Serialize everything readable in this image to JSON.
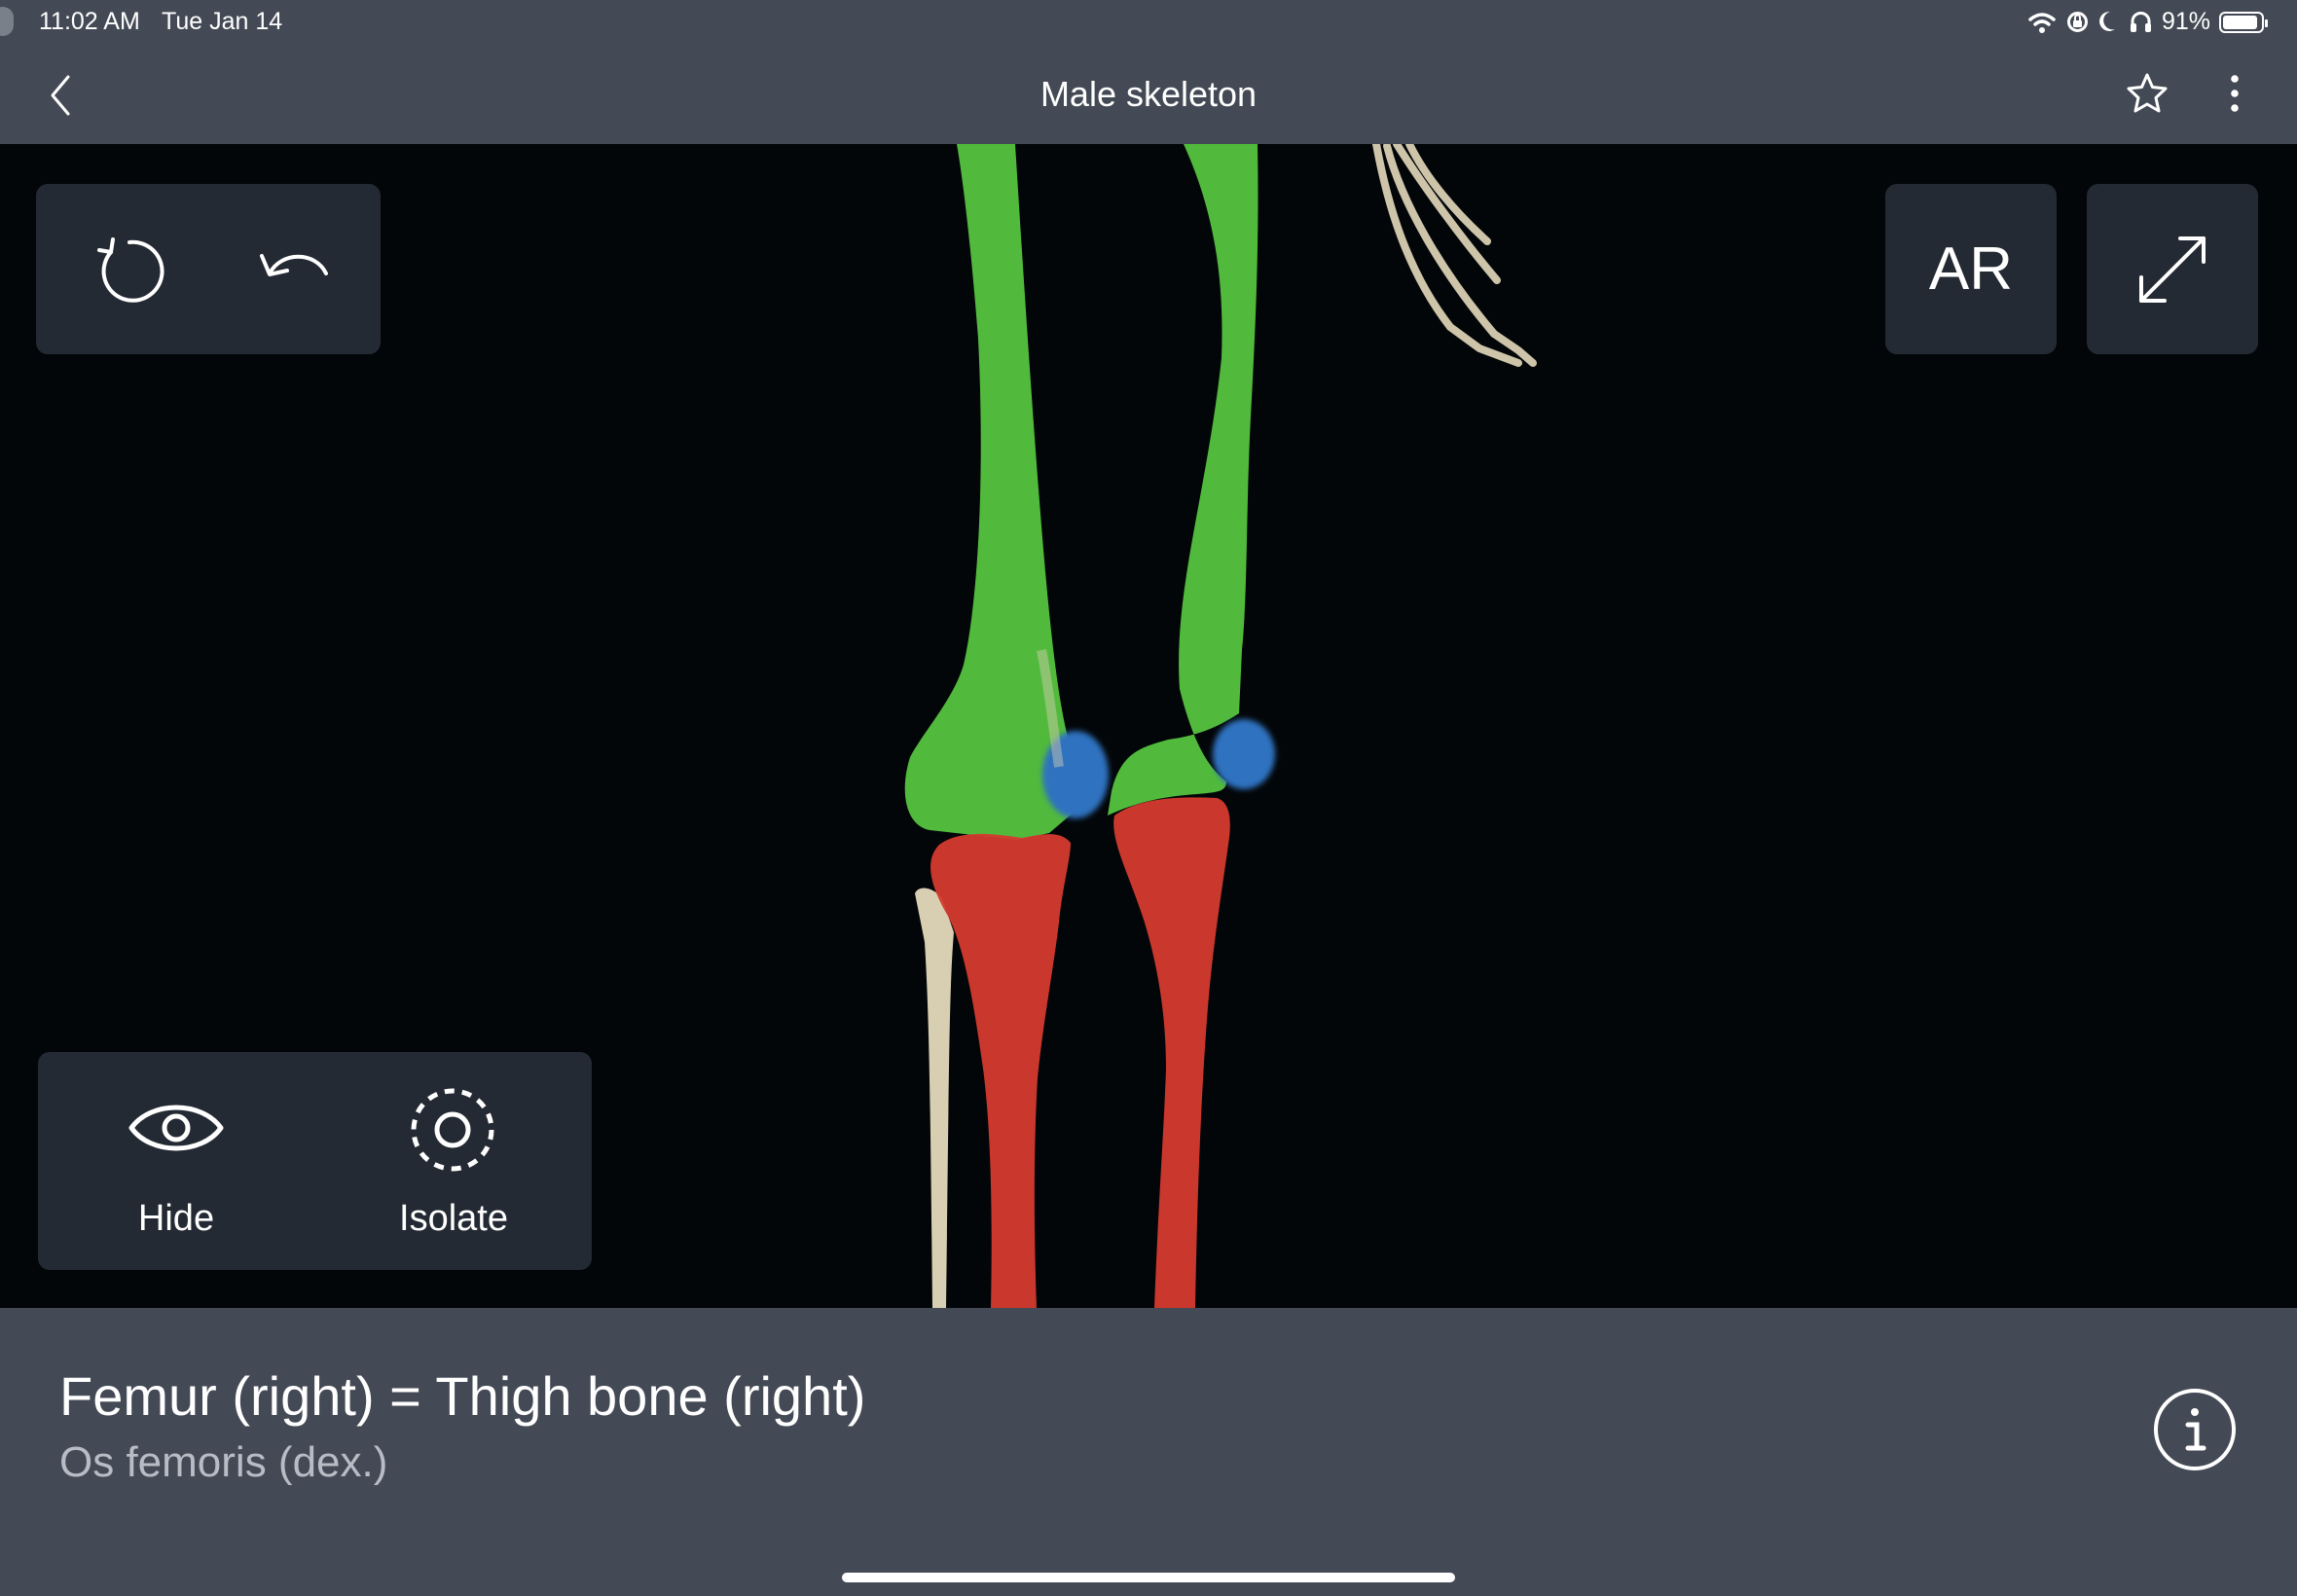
{
  "status_bar": {
    "time": "11:02 AM",
    "date": "Tue Jan 14",
    "battery": "91%",
    "battery_level": 0.91,
    "icons": [
      "wifi-icon",
      "orientation-lock-icon",
      "moon-icon",
      "headphones-icon",
      "battery-icon"
    ]
  },
  "header": {
    "title": "Male skeleton",
    "back_icon": "chevron-left-icon",
    "favorite_icon": "star-icon",
    "menu_icon": "more-vertical-icon"
  },
  "toolbar": {
    "reset_icon": "rotate-reset-icon",
    "undo_icon": "undo-icon",
    "ar_label": "AR",
    "fullscreen_icon": "expand-icon"
  },
  "actions": {
    "hide_label": "Hide",
    "isolate_label": "Isolate",
    "hide_icon": "eye-icon",
    "isolate_icon": "dashed-target-icon"
  },
  "selection": {
    "name": "Femur (right) = Thigh bone (right)",
    "latin_name": "Os femoris (dex.)",
    "info_icon": "info-icon"
  },
  "model_colors": {
    "femur": "#55c43f",
    "patella": "#2f72c0",
    "tibia": "#d53a2f",
    "bone": "#d8cfb2"
  }
}
